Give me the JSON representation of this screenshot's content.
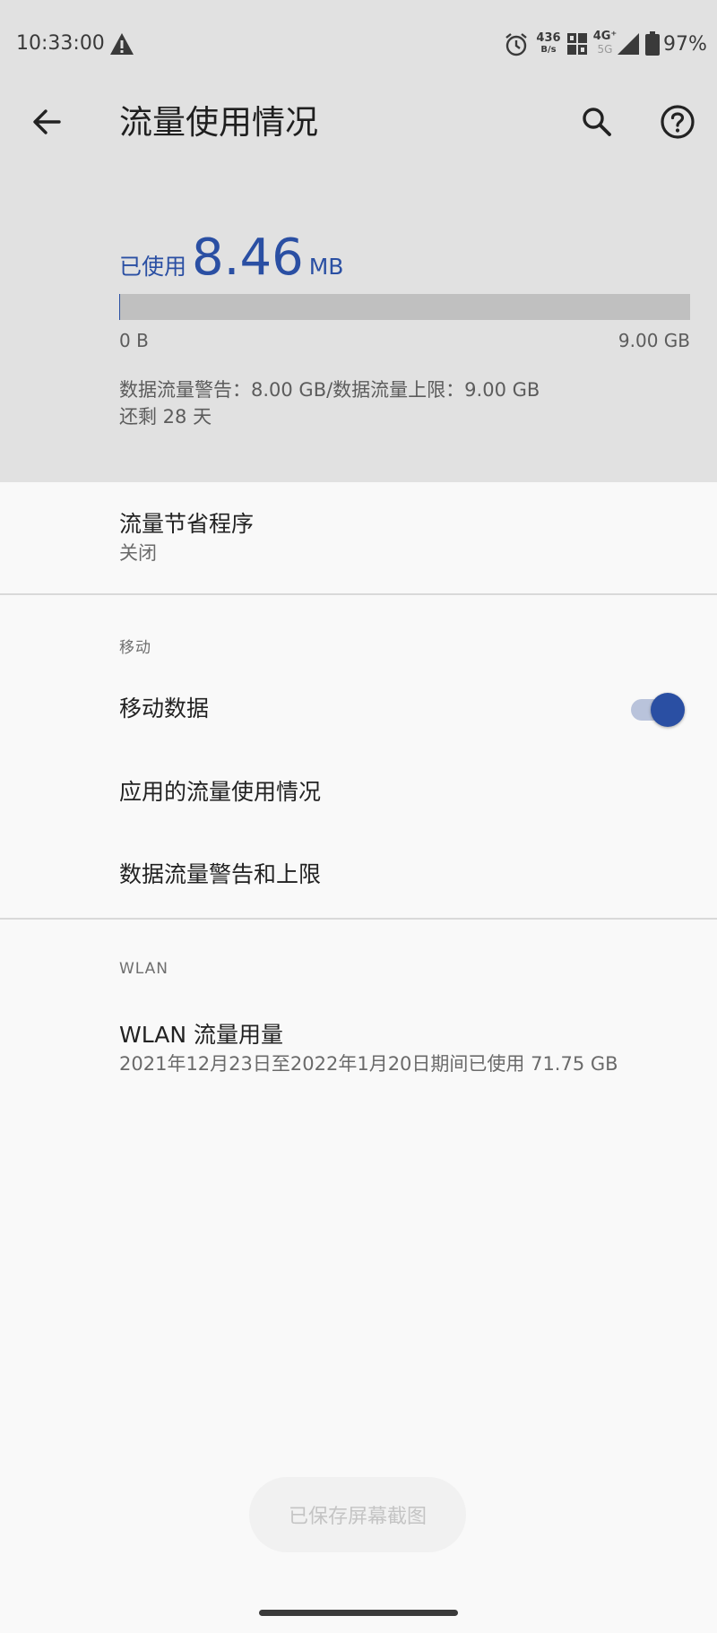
{
  "status_bar": {
    "time": "10:33:00",
    "net_speed_value": "436",
    "net_speed_unit": "B/s",
    "network_type_top": "4G⁺",
    "network_type_bottom": "5G",
    "battery": "97%",
    "icons": [
      "warning-icon",
      "alarm-icon",
      "hd-icon",
      "signal-icon",
      "battery-icon"
    ]
  },
  "app_bar": {
    "title": "流量使用情况",
    "icons": [
      "back-arrow-icon",
      "search-icon",
      "help-icon"
    ]
  },
  "usage": {
    "prefix": "已使用",
    "value": "8.46",
    "unit": "MB",
    "fraction_used": 0.0009,
    "bar_min": "0 B",
    "bar_max": "9.00 GB",
    "warning_line": "数据流量警告：8.00 GB/数据流量上限：9.00 GB",
    "remaining": "还剩 28 天"
  },
  "data_saver": {
    "title": "流量节省程序",
    "status": "关闭"
  },
  "mobile_section": {
    "header": "移动",
    "mobile_data_label": "移动数据",
    "mobile_data_enabled": true,
    "app_usage_label": "应用的流量使用情况",
    "warning_limit_label": "数据流量警告和上限"
  },
  "wlan_section": {
    "header": "WLAN",
    "usage_title": "WLAN 流量用量",
    "usage_summary": "2021年12月23日至2022年1月20日期间已使用 71.75 GB"
  },
  "toast": {
    "text": "已保存屏幕截图"
  },
  "colors": {
    "accent": "#2a4fa3",
    "header_bg": "#e1e1e1",
    "page_bg": "#f9f9f9"
  }
}
